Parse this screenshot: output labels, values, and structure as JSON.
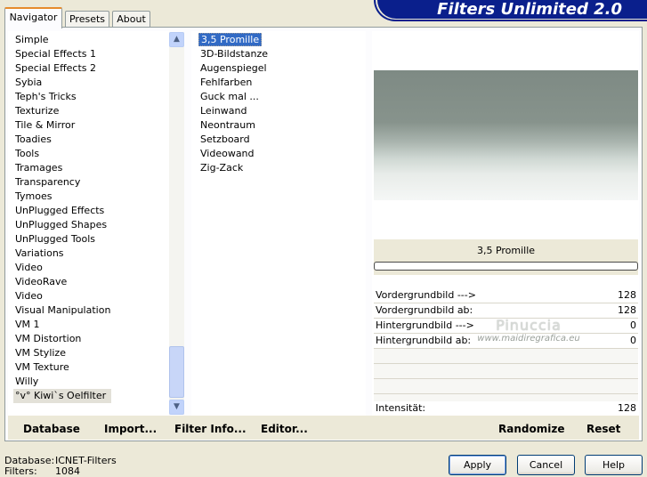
{
  "header": {
    "title": "Filters Unlimited 2.0"
  },
  "tabs": [
    "Navigator",
    "Presets",
    "About"
  ],
  "categories": [
    "Simple",
    "Special Effects 1",
    "Special Effects 2",
    "Sybia",
    "Teph's Tricks",
    "Texturize",
    "Tile & Mirror",
    "Toadies",
    "Tools",
    "Tramages",
    "Transparency",
    "Tymoes",
    "UnPlugged Effects",
    "UnPlugged Shapes",
    "UnPlugged Tools",
    "Variations",
    "Video",
    "VideoRave",
    "Video",
    "Visual Manipulation",
    "VM 1",
    "VM Distortion",
    "VM Stylize",
    "VM Texture",
    "Willy",
    "°v° Kiwi`s Oelfilter"
  ],
  "selected_category": "°v° Kiwi`s Oelfilter",
  "filters": [
    "3,5 Promille",
    "3D-Bildstanze",
    "Augenspiegel",
    "Fehlfarben",
    "Guck mal ...",
    "Leinwand",
    "Neontraum",
    "Setzboard",
    "Videowand",
    "Zig-Zack"
  ],
  "selected_filter": "3,5 Promille",
  "preview": {
    "filter_name": "3,5 Promille"
  },
  "sliders": [
    {
      "label": "Vordergrundbild --->",
      "value": "128"
    },
    {
      "label": "Vordergrundbild ab:",
      "value": "128"
    },
    {
      "label": "Hintergrundbild --->",
      "value": "0"
    },
    {
      "label": "Hintergrundbild ab:",
      "value": "0"
    }
  ],
  "intensity": {
    "label": "Intensität:",
    "value": "128"
  },
  "watermark": {
    "line1": "Pinuccia",
    "line2": "www.maidiregrafica.eu"
  },
  "toolbar": {
    "database": "Database",
    "import": "Import...",
    "filter_info": "Filter Info...",
    "editor": "Editor...",
    "randomize": "Randomize",
    "reset": "Reset"
  },
  "footer": {
    "database_label": "Database:",
    "database_value": "ICNET-Filters",
    "filters_label": "Filters:",
    "filters_value": "1084"
  },
  "buttons": {
    "apply": "Apply",
    "cancel": "Cancel",
    "help": "Help"
  },
  "colors": {
    "selection": "#316AC5",
    "logo_bg": "#0A1F8C",
    "window_bg": "#ECE9D8"
  }
}
